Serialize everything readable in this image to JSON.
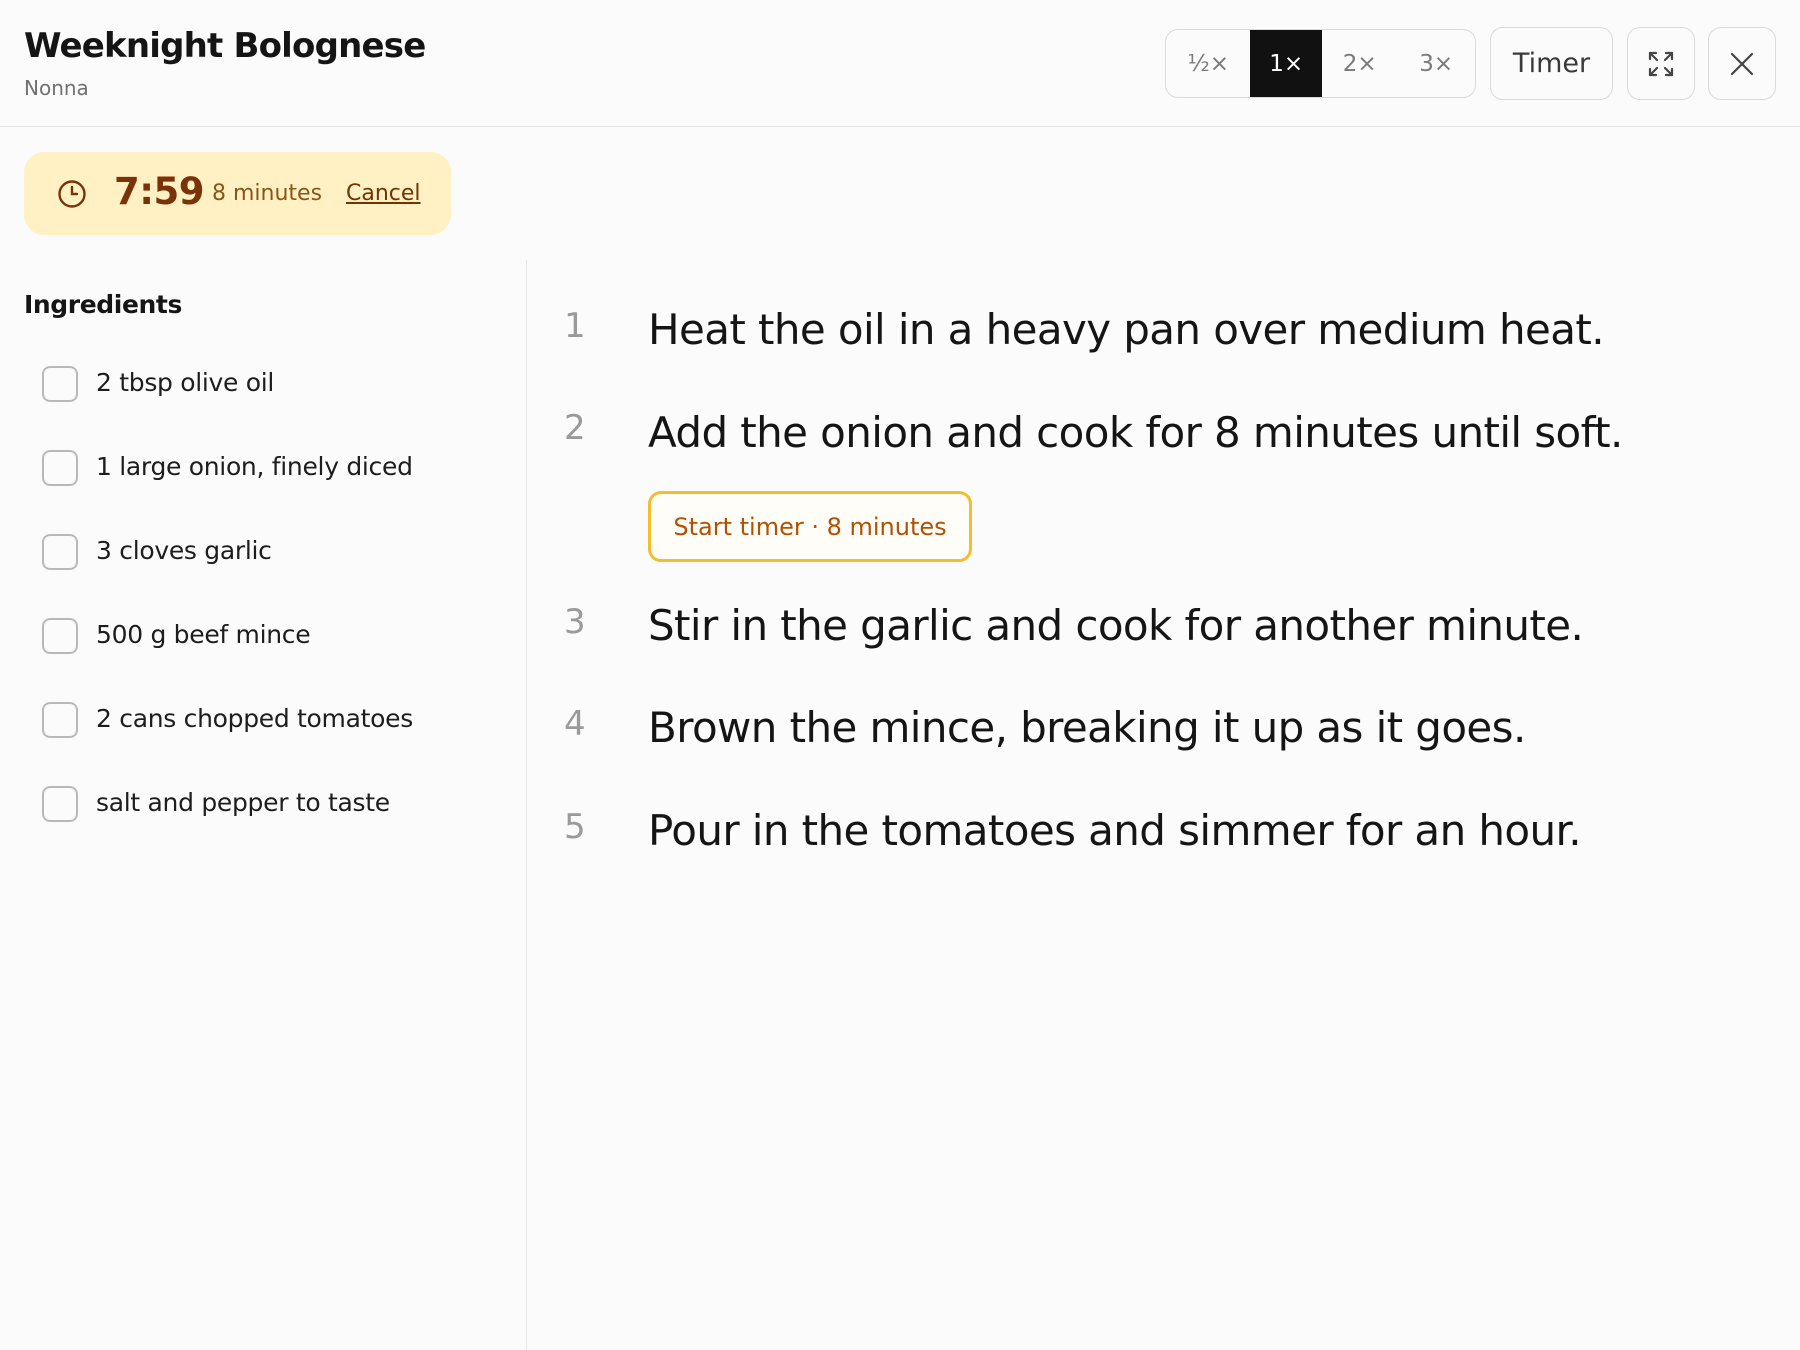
{
  "recipe": {
    "title": "Weeknight Bolognese",
    "author": "Nonna"
  },
  "toolbar": {
    "scales": [
      "½×",
      "1×",
      "2×",
      "3×"
    ],
    "active_scale": "1×",
    "timer_label": "Timer",
    "expand_icon": "expand-icon",
    "close_icon": "close-icon"
  },
  "timer": {
    "remaining": "7:59",
    "duration": "8 minutes",
    "cancel_label": "Cancel",
    "icon": "clock-icon"
  },
  "ingredients": {
    "title": "Ingredients",
    "items": [
      "2 tbsp olive oil",
      "1 large onion, finely diced",
      "3 cloves garlic",
      "500 g beef mince",
      "2 cans chopped tomatoes",
      "salt and pepper to taste"
    ]
  },
  "steps": [
    {
      "num": "1",
      "text": "Heat the oil in a heavy pan over medium heat."
    },
    {
      "num": "2",
      "text": "Add the onion and cook for 8 minutes until soft."
    },
    {
      "num": "3",
      "text": "Stir in the garlic and cook for another minute."
    },
    {
      "num": "4",
      "text": "Brown the mince, breaking it up as it goes."
    },
    {
      "num": "5",
      "text": "Pour in the tomatoes and simmer for an hour."
    }
  ],
  "step_timer": {
    "label": "Start timer · 8 minutes"
  },
  "colors": {
    "accent_dark": "#111111",
    "timer_bg": "#fff1c4",
    "timer_text": "#7a3208",
    "timer_button_border": "#f5bd2c",
    "timer_button_text": "#b25004"
  }
}
